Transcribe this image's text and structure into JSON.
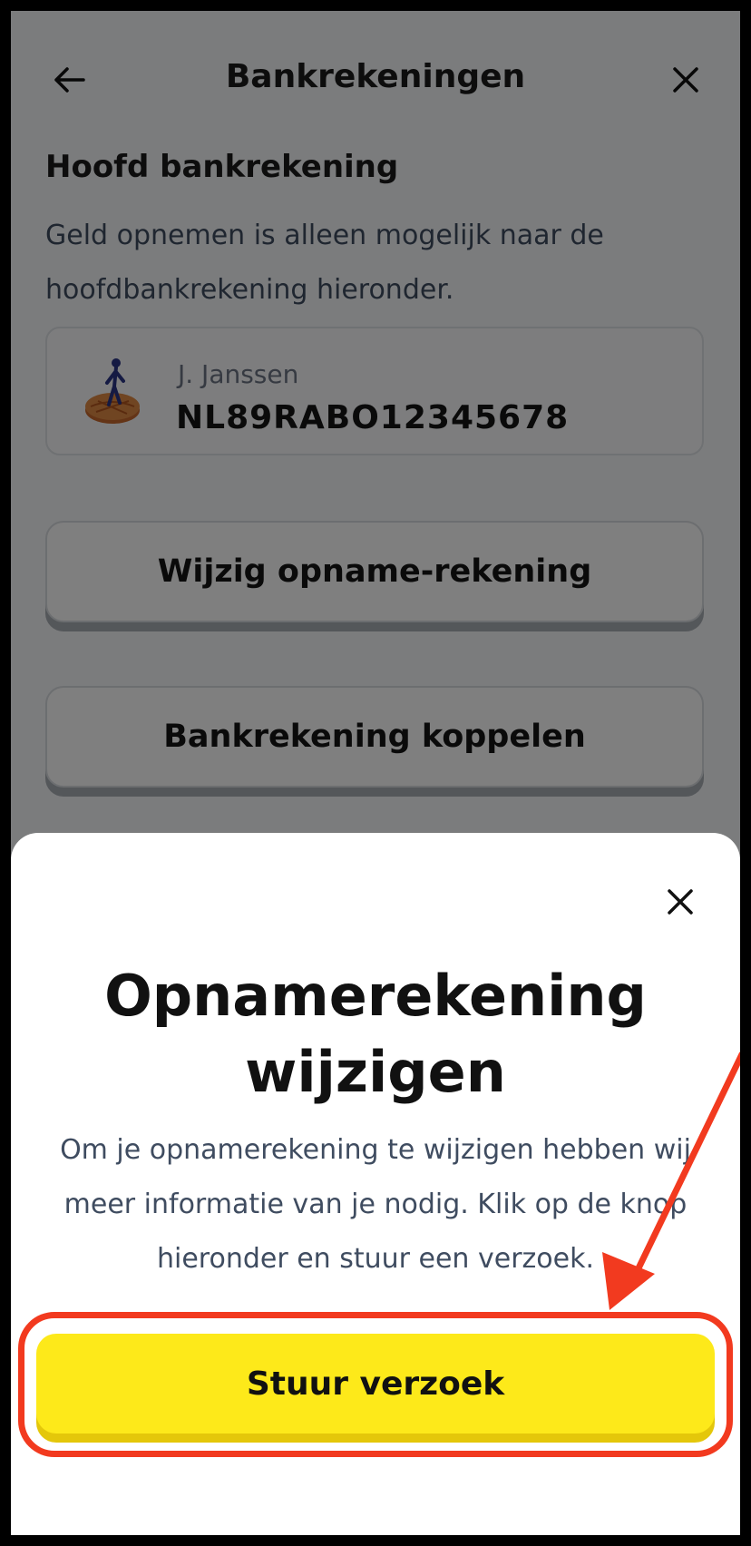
{
  "header": {
    "title": "Bankrekeningen",
    "back_icon": "arrow-left-icon",
    "close_icon": "close-icon"
  },
  "main_account": {
    "section_title": "Hoofd bankrekening",
    "description": "Geld opnemen is alleen mogelijk naar de hoofdbankrekening hieronder.",
    "holder": "J. Janssen",
    "iban": "NL89RABO12345678",
    "bank_logo_icon": "bank-logo-icon"
  },
  "buttons": {
    "change_withdrawal": "Wijzig opname-rekening",
    "link_account": "Bankrekening koppelen"
  },
  "sheet": {
    "title": "Opnamerekening wijzigen",
    "body": "Om je opnamerekening te wijzigen hebben wij meer informatie van je nodig. Klik op de knop hieronder en stuur een verzoek.",
    "primary_button": "Stuur verzoek",
    "close_icon": "close-icon"
  },
  "colors": {
    "accent_yellow": "#fde91a",
    "annotation_red": "#f23a1f",
    "text_muted": "#3f4c60"
  }
}
